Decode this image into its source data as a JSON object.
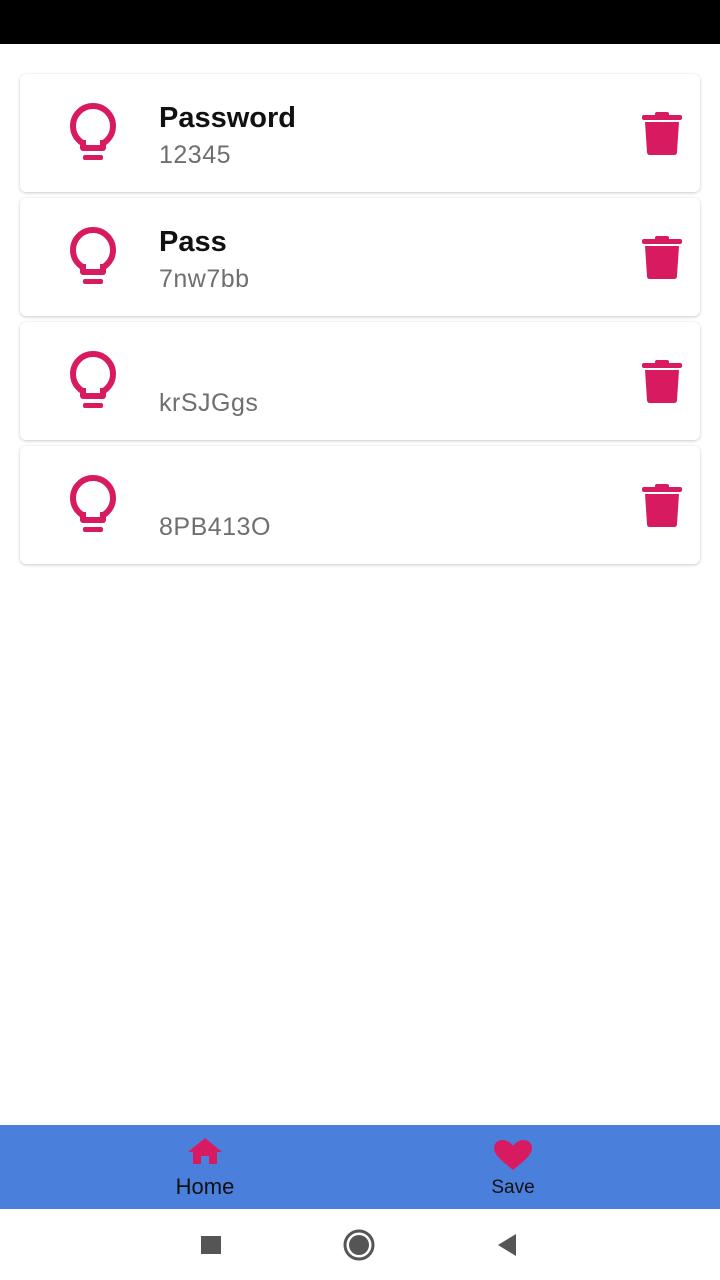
{
  "colors": {
    "accent": "#d81b60",
    "nav_bar": "#4a7fdc",
    "title_text": "#111111",
    "value_text": "#6f6f6f",
    "status_bar": "#000000"
  },
  "entries": [
    {
      "title": "Password",
      "value": "12345",
      "icon": "lightbulb-icon",
      "action_icon": "trash-icon"
    },
    {
      "title": "Pass",
      "value": "7nw7bb",
      "icon": "lightbulb-icon",
      "action_icon": "trash-icon"
    },
    {
      "title": "",
      "value": "krSJGgs",
      "icon": "lightbulb-icon",
      "action_icon": "trash-icon"
    },
    {
      "title": "",
      "value": "8PB413O",
      "icon": "lightbulb-icon",
      "action_icon": "trash-icon"
    }
  ],
  "bottom_nav": {
    "items": [
      {
        "label": "Home",
        "icon": "home-icon",
        "active": true
      },
      {
        "label": "Save",
        "icon": "heart-icon",
        "active": false
      }
    ]
  },
  "system_nav": {
    "buttons": [
      "recents-icon",
      "home-circle-icon",
      "back-icon"
    ]
  }
}
